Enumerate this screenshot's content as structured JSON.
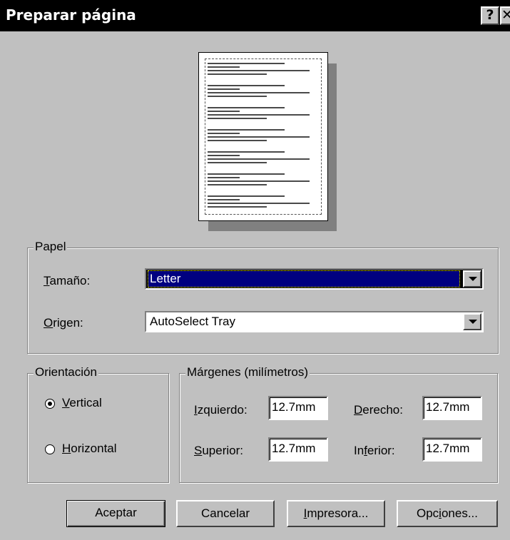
{
  "window": {
    "title": "Preparar página",
    "help_glyph": "?",
    "close_glyph": "✕"
  },
  "paper": {
    "group_label": "Papel",
    "size_label_accel": "T",
    "size_label_rest": "amaño:",
    "size_value": "Letter",
    "source_label_accel": "O",
    "source_label_rest": "rigen:",
    "source_value": "AutoSelect Tray"
  },
  "orientation": {
    "group_label": "Orientación",
    "portrait_accel": "V",
    "portrait_rest": "ertical",
    "landscape_accel": "H",
    "landscape_rest": "orizontal",
    "selected": "portrait"
  },
  "margins": {
    "group_label": "Márgenes (milímetros)",
    "left_accel": "I",
    "left_rest": "zquierdo:",
    "left_value": "12.7mm",
    "right_accel": "D",
    "right_rest": "erecho:",
    "right_value": "12.7mm",
    "top_accel": "S",
    "top_rest": "uperior:",
    "top_value": "12.7mm",
    "bottom_pre": "In",
    "bottom_accel": "f",
    "bottom_rest": "erior:",
    "bottom_value": "12.7mm"
  },
  "buttons": {
    "ok": "Aceptar",
    "cancel": "Cancelar",
    "printer_accel": "I",
    "printer_rest": "mpresora...",
    "options_pre": "Opc",
    "options_accel": "i",
    "options_rest": "ones..."
  },
  "colors": {
    "face": "#c0c0c0",
    "title_bar": "#000000",
    "selection": "#000080"
  }
}
